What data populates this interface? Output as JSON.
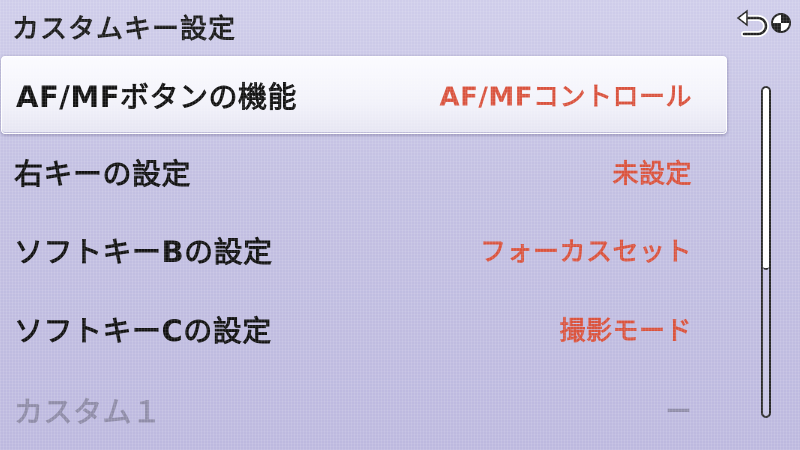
{
  "header": {
    "title": "カスタムキー設定",
    "back_icon": "return-arrow-icon",
    "dial_icon": "dial-icon"
  },
  "menu": {
    "items": [
      {
        "label": "AF/MFボタンの機能",
        "value": "AF/MFコントロール",
        "selected": true,
        "enabled": true
      },
      {
        "label": "右キーの設定",
        "value": "未設定",
        "selected": false,
        "enabled": true
      },
      {
        "label": "ソフトキーBの設定",
        "value": "フォーカスセット",
        "selected": false,
        "enabled": true
      },
      {
        "label": "ソフトキーCの設定",
        "value": "撮影モード",
        "selected": false,
        "enabled": true
      },
      {
        "label": "カスタム１",
        "value": "ー",
        "selected": false,
        "enabled": false
      }
    ]
  },
  "scroll": {
    "position_fraction": 0.0,
    "visible_fraction": 0.55
  },
  "colors": {
    "background": "#c6c3e4",
    "value_text": "#d9533e",
    "selected_row": "#f5f5fb",
    "disabled_text": "#8f8ca8"
  }
}
